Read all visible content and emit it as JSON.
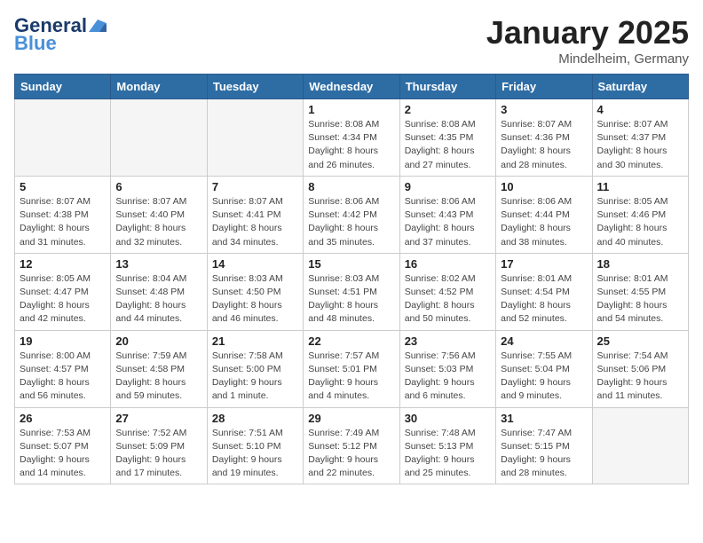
{
  "header": {
    "logo_general": "General",
    "logo_blue": "Blue",
    "month": "January 2025",
    "location": "Mindelheim, Germany"
  },
  "weekdays": [
    "Sunday",
    "Monday",
    "Tuesday",
    "Wednesday",
    "Thursday",
    "Friday",
    "Saturday"
  ],
  "weeks": [
    [
      {
        "day": "",
        "info": ""
      },
      {
        "day": "",
        "info": ""
      },
      {
        "day": "",
        "info": ""
      },
      {
        "day": "1",
        "info": "Sunrise: 8:08 AM\nSunset: 4:34 PM\nDaylight: 8 hours\nand 26 minutes."
      },
      {
        "day": "2",
        "info": "Sunrise: 8:08 AM\nSunset: 4:35 PM\nDaylight: 8 hours\nand 27 minutes."
      },
      {
        "day": "3",
        "info": "Sunrise: 8:07 AM\nSunset: 4:36 PM\nDaylight: 8 hours\nand 28 minutes."
      },
      {
        "day": "4",
        "info": "Sunrise: 8:07 AM\nSunset: 4:37 PM\nDaylight: 8 hours\nand 30 minutes."
      }
    ],
    [
      {
        "day": "5",
        "info": "Sunrise: 8:07 AM\nSunset: 4:38 PM\nDaylight: 8 hours\nand 31 minutes."
      },
      {
        "day": "6",
        "info": "Sunrise: 8:07 AM\nSunset: 4:40 PM\nDaylight: 8 hours\nand 32 minutes."
      },
      {
        "day": "7",
        "info": "Sunrise: 8:07 AM\nSunset: 4:41 PM\nDaylight: 8 hours\nand 34 minutes."
      },
      {
        "day": "8",
        "info": "Sunrise: 8:06 AM\nSunset: 4:42 PM\nDaylight: 8 hours\nand 35 minutes."
      },
      {
        "day": "9",
        "info": "Sunrise: 8:06 AM\nSunset: 4:43 PM\nDaylight: 8 hours\nand 37 minutes."
      },
      {
        "day": "10",
        "info": "Sunrise: 8:06 AM\nSunset: 4:44 PM\nDaylight: 8 hours\nand 38 minutes."
      },
      {
        "day": "11",
        "info": "Sunrise: 8:05 AM\nSunset: 4:46 PM\nDaylight: 8 hours\nand 40 minutes."
      }
    ],
    [
      {
        "day": "12",
        "info": "Sunrise: 8:05 AM\nSunset: 4:47 PM\nDaylight: 8 hours\nand 42 minutes."
      },
      {
        "day": "13",
        "info": "Sunrise: 8:04 AM\nSunset: 4:48 PM\nDaylight: 8 hours\nand 44 minutes."
      },
      {
        "day": "14",
        "info": "Sunrise: 8:03 AM\nSunset: 4:50 PM\nDaylight: 8 hours\nand 46 minutes."
      },
      {
        "day": "15",
        "info": "Sunrise: 8:03 AM\nSunset: 4:51 PM\nDaylight: 8 hours\nand 48 minutes."
      },
      {
        "day": "16",
        "info": "Sunrise: 8:02 AM\nSunset: 4:52 PM\nDaylight: 8 hours\nand 50 minutes."
      },
      {
        "day": "17",
        "info": "Sunrise: 8:01 AM\nSunset: 4:54 PM\nDaylight: 8 hours\nand 52 minutes."
      },
      {
        "day": "18",
        "info": "Sunrise: 8:01 AM\nSunset: 4:55 PM\nDaylight: 8 hours\nand 54 minutes."
      }
    ],
    [
      {
        "day": "19",
        "info": "Sunrise: 8:00 AM\nSunset: 4:57 PM\nDaylight: 8 hours\nand 56 minutes."
      },
      {
        "day": "20",
        "info": "Sunrise: 7:59 AM\nSunset: 4:58 PM\nDaylight: 8 hours\nand 59 minutes."
      },
      {
        "day": "21",
        "info": "Sunrise: 7:58 AM\nSunset: 5:00 PM\nDaylight: 9 hours\nand 1 minute."
      },
      {
        "day": "22",
        "info": "Sunrise: 7:57 AM\nSunset: 5:01 PM\nDaylight: 9 hours\nand 4 minutes."
      },
      {
        "day": "23",
        "info": "Sunrise: 7:56 AM\nSunset: 5:03 PM\nDaylight: 9 hours\nand 6 minutes."
      },
      {
        "day": "24",
        "info": "Sunrise: 7:55 AM\nSunset: 5:04 PM\nDaylight: 9 hours\nand 9 minutes."
      },
      {
        "day": "25",
        "info": "Sunrise: 7:54 AM\nSunset: 5:06 PM\nDaylight: 9 hours\nand 11 minutes."
      }
    ],
    [
      {
        "day": "26",
        "info": "Sunrise: 7:53 AM\nSunset: 5:07 PM\nDaylight: 9 hours\nand 14 minutes."
      },
      {
        "day": "27",
        "info": "Sunrise: 7:52 AM\nSunset: 5:09 PM\nDaylight: 9 hours\nand 17 minutes."
      },
      {
        "day": "28",
        "info": "Sunrise: 7:51 AM\nSunset: 5:10 PM\nDaylight: 9 hours\nand 19 minutes."
      },
      {
        "day": "29",
        "info": "Sunrise: 7:49 AM\nSunset: 5:12 PM\nDaylight: 9 hours\nand 22 minutes."
      },
      {
        "day": "30",
        "info": "Sunrise: 7:48 AM\nSunset: 5:13 PM\nDaylight: 9 hours\nand 25 minutes."
      },
      {
        "day": "31",
        "info": "Sunrise: 7:47 AM\nSunset: 5:15 PM\nDaylight: 9 hours\nand 28 minutes."
      },
      {
        "day": "",
        "info": ""
      }
    ]
  ]
}
